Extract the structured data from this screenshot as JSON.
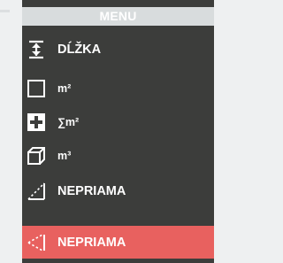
{
  "menu": {
    "title": "MENU",
    "items": [
      {
        "label": "DĹŽKA",
        "icon": "length-arrows-icon",
        "active": false
      },
      {
        "label": "m²",
        "icon": "square-area-icon",
        "active": false
      },
      {
        "label": "∑m²",
        "icon": "sum-area-icon",
        "active": false
      },
      {
        "label": "m³",
        "icon": "cube-volume-icon",
        "active": false
      },
      {
        "label": "NEPRIAMA",
        "icon": "indirect-triangle-icon",
        "active": false
      },
      {
        "label": "NEPRIAMA",
        "icon": "indirect-angle-icon",
        "active": true
      }
    ]
  },
  "colors": {
    "menu_background": "#3c3d3b",
    "header_background": "#d8dcdd",
    "active_item": "#e8615f",
    "page_background": "#eef0f1"
  }
}
